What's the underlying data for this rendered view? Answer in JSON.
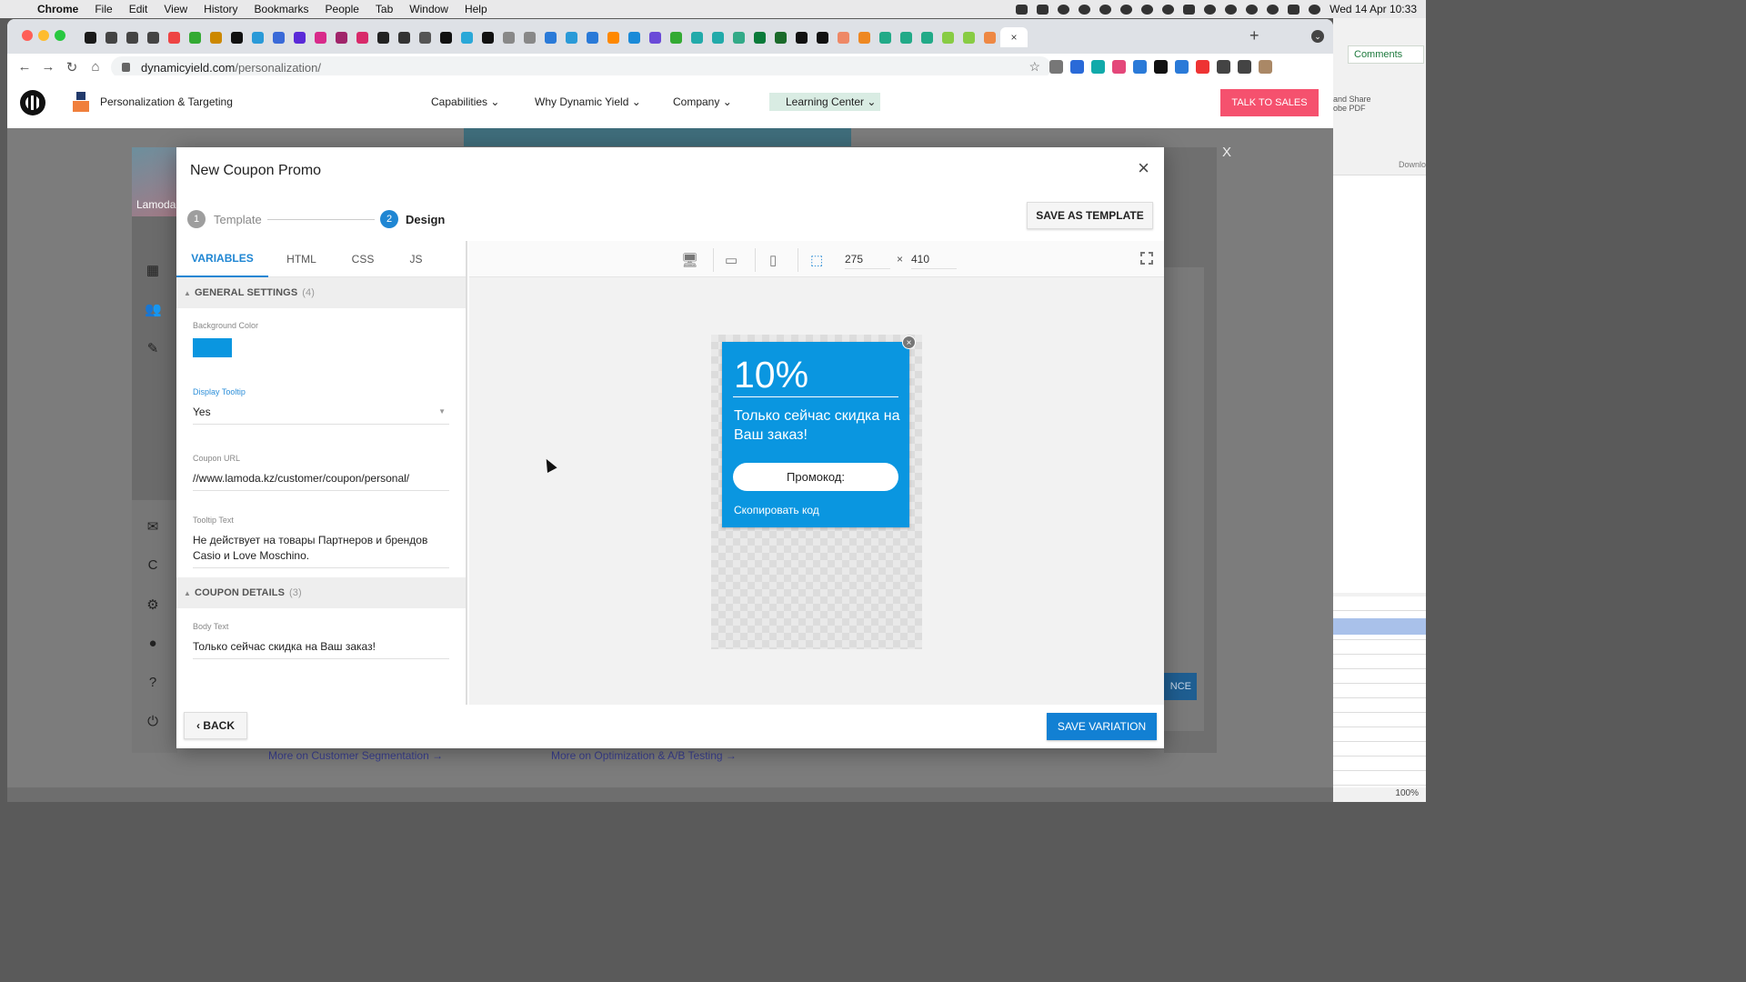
{
  "menubar": {
    "app": "Chrome",
    "items": [
      "File",
      "Edit",
      "View",
      "History",
      "Bookmarks",
      "People",
      "Tab",
      "Window",
      "Help"
    ],
    "datetime": "Wed 14 Apr  10:33"
  },
  "browser": {
    "url_domain": "dynamicyield.com",
    "url_path": "/personalization/",
    "tab_close": "×",
    "new_tab": "+",
    "tab_favicon_colors": [
      "#1a1a1a",
      "#444",
      "#444",
      "#444",
      "#e44",
      "#3a3",
      "#c80",
      "#111",
      "#2a9ad8",
      "#3a6ad8",
      "#5a2ad8",
      "#d82a8a",
      "#a0246a",
      "#d82a6a",
      "#222",
      "#333",
      "#555",
      "#111",
      "#2aa8d8",
      "#111",
      "#888",
      "#888",
      "#2a7ad8",
      "#2a9ad8",
      "#2a7ad8",
      "#f80",
      "#1a8ad8",
      "#6a4ad8",
      "#3a3",
      "#2aa",
      "#2aa",
      "#3a8",
      "#0a7a3a",
      "#1a6a2a",
      "#111",
      "#111",
      "#e86",
      "#e82",
      "#2a8",
      "#2a8",
      "#2a8",
      "#8c4",
      "#8c4",
      "#e84"
    ],
    "ext_colors": [
      "#777",
      "#2a6ad8",
      "#1aa",
      "#e4477a",
      "#2a7ad8",
      "#111",
      "#2a7ad8",
      "#e33",
      "#444",
      "#444",
      "#a86"
    ]
  },
  "right_window": {
    "comments_label": "Comments",
    "share_label_1": "and Share",
    "share_label_2": "obe PDF",
    "download_label": "Downlo",
    "zoom": "100%"
  },
  "site": {
    "product_name": "Personalization & Targeting",
    "nav": [
      "Capabilities",
      "Why Dynamic Yield",
      "Company"
    ],
    "learning_center": "Learning Center",
    "cta": "TALK TO SALES",
    "overlay_close": "X",
    "link_segmentation": "More on Customer Segmentation →",
    "link_optimization": "More on Optimization & A/B Testing →"
  },
  "app_bg": {
    "account_label": "Lamoda",
    "right_button_fragment": "NCE"
  },
  "modal": {
    "title": "New Coupon Promo",
    "close_icon": "×",
    "steps": [
      {
        "number": "1",
        "label": "Template",
        "state": "completed"
      },
      {
        "number": "2",
        "label": "Design",
        "state": "active"
      }
    ],
    "save_as_template": "SAVE AS TEMPLATE",
    "editor_tabs": [
      "VARIABLES",
      "HTML",
      "CSS",
      "JS"
    ],
    "active_tab": "VARIABLES",
    "sections": {
      "general": {
        "title": "GENERAL SETTINGS",
        "count": "(4)",
        "fields": {
          "background_color_label": "Background Color",
          "background_color_value": "#0a96e0",
          "display_tooltip_label": "Display Tooltip",
          "display_tooltip_value": "Yes",
          "coupon_url_label": "Coupon URL",
          "coupon_url_value": "//www.lamoda.kz/customer/coupon/personal/",
          "tooltip_text_label": "Tooltip Text",
          "tooltip_text_value": "Не действует на товары Партнеров и брендов Casio и Love Moschino."
        }
      },
      "coupon": {
        "title": "COUPON DETAILS",
        "count": "(3)",
        "fields": {
          "body_text_label": "Body Text",
          "body_text_value": "Только сейчас скидка на Ваш заказ!"
        }
      }
    },
    "preview": {
      "width": "275",
      "times": "×",
      "height": "410",
      "coupon": {
        "discount": "10%",
        "body": "Только сейчас скидка на Ваш заказ!",
        "code_label": "Промокод:",
        "copy_label": "Скопировать код",
        "close_icon": "×",
        "color": "#0a96e0"
      }
    },
    "back": "‹ BACK",
    "save_variation": "SAVE VARIATION"
  }
}
